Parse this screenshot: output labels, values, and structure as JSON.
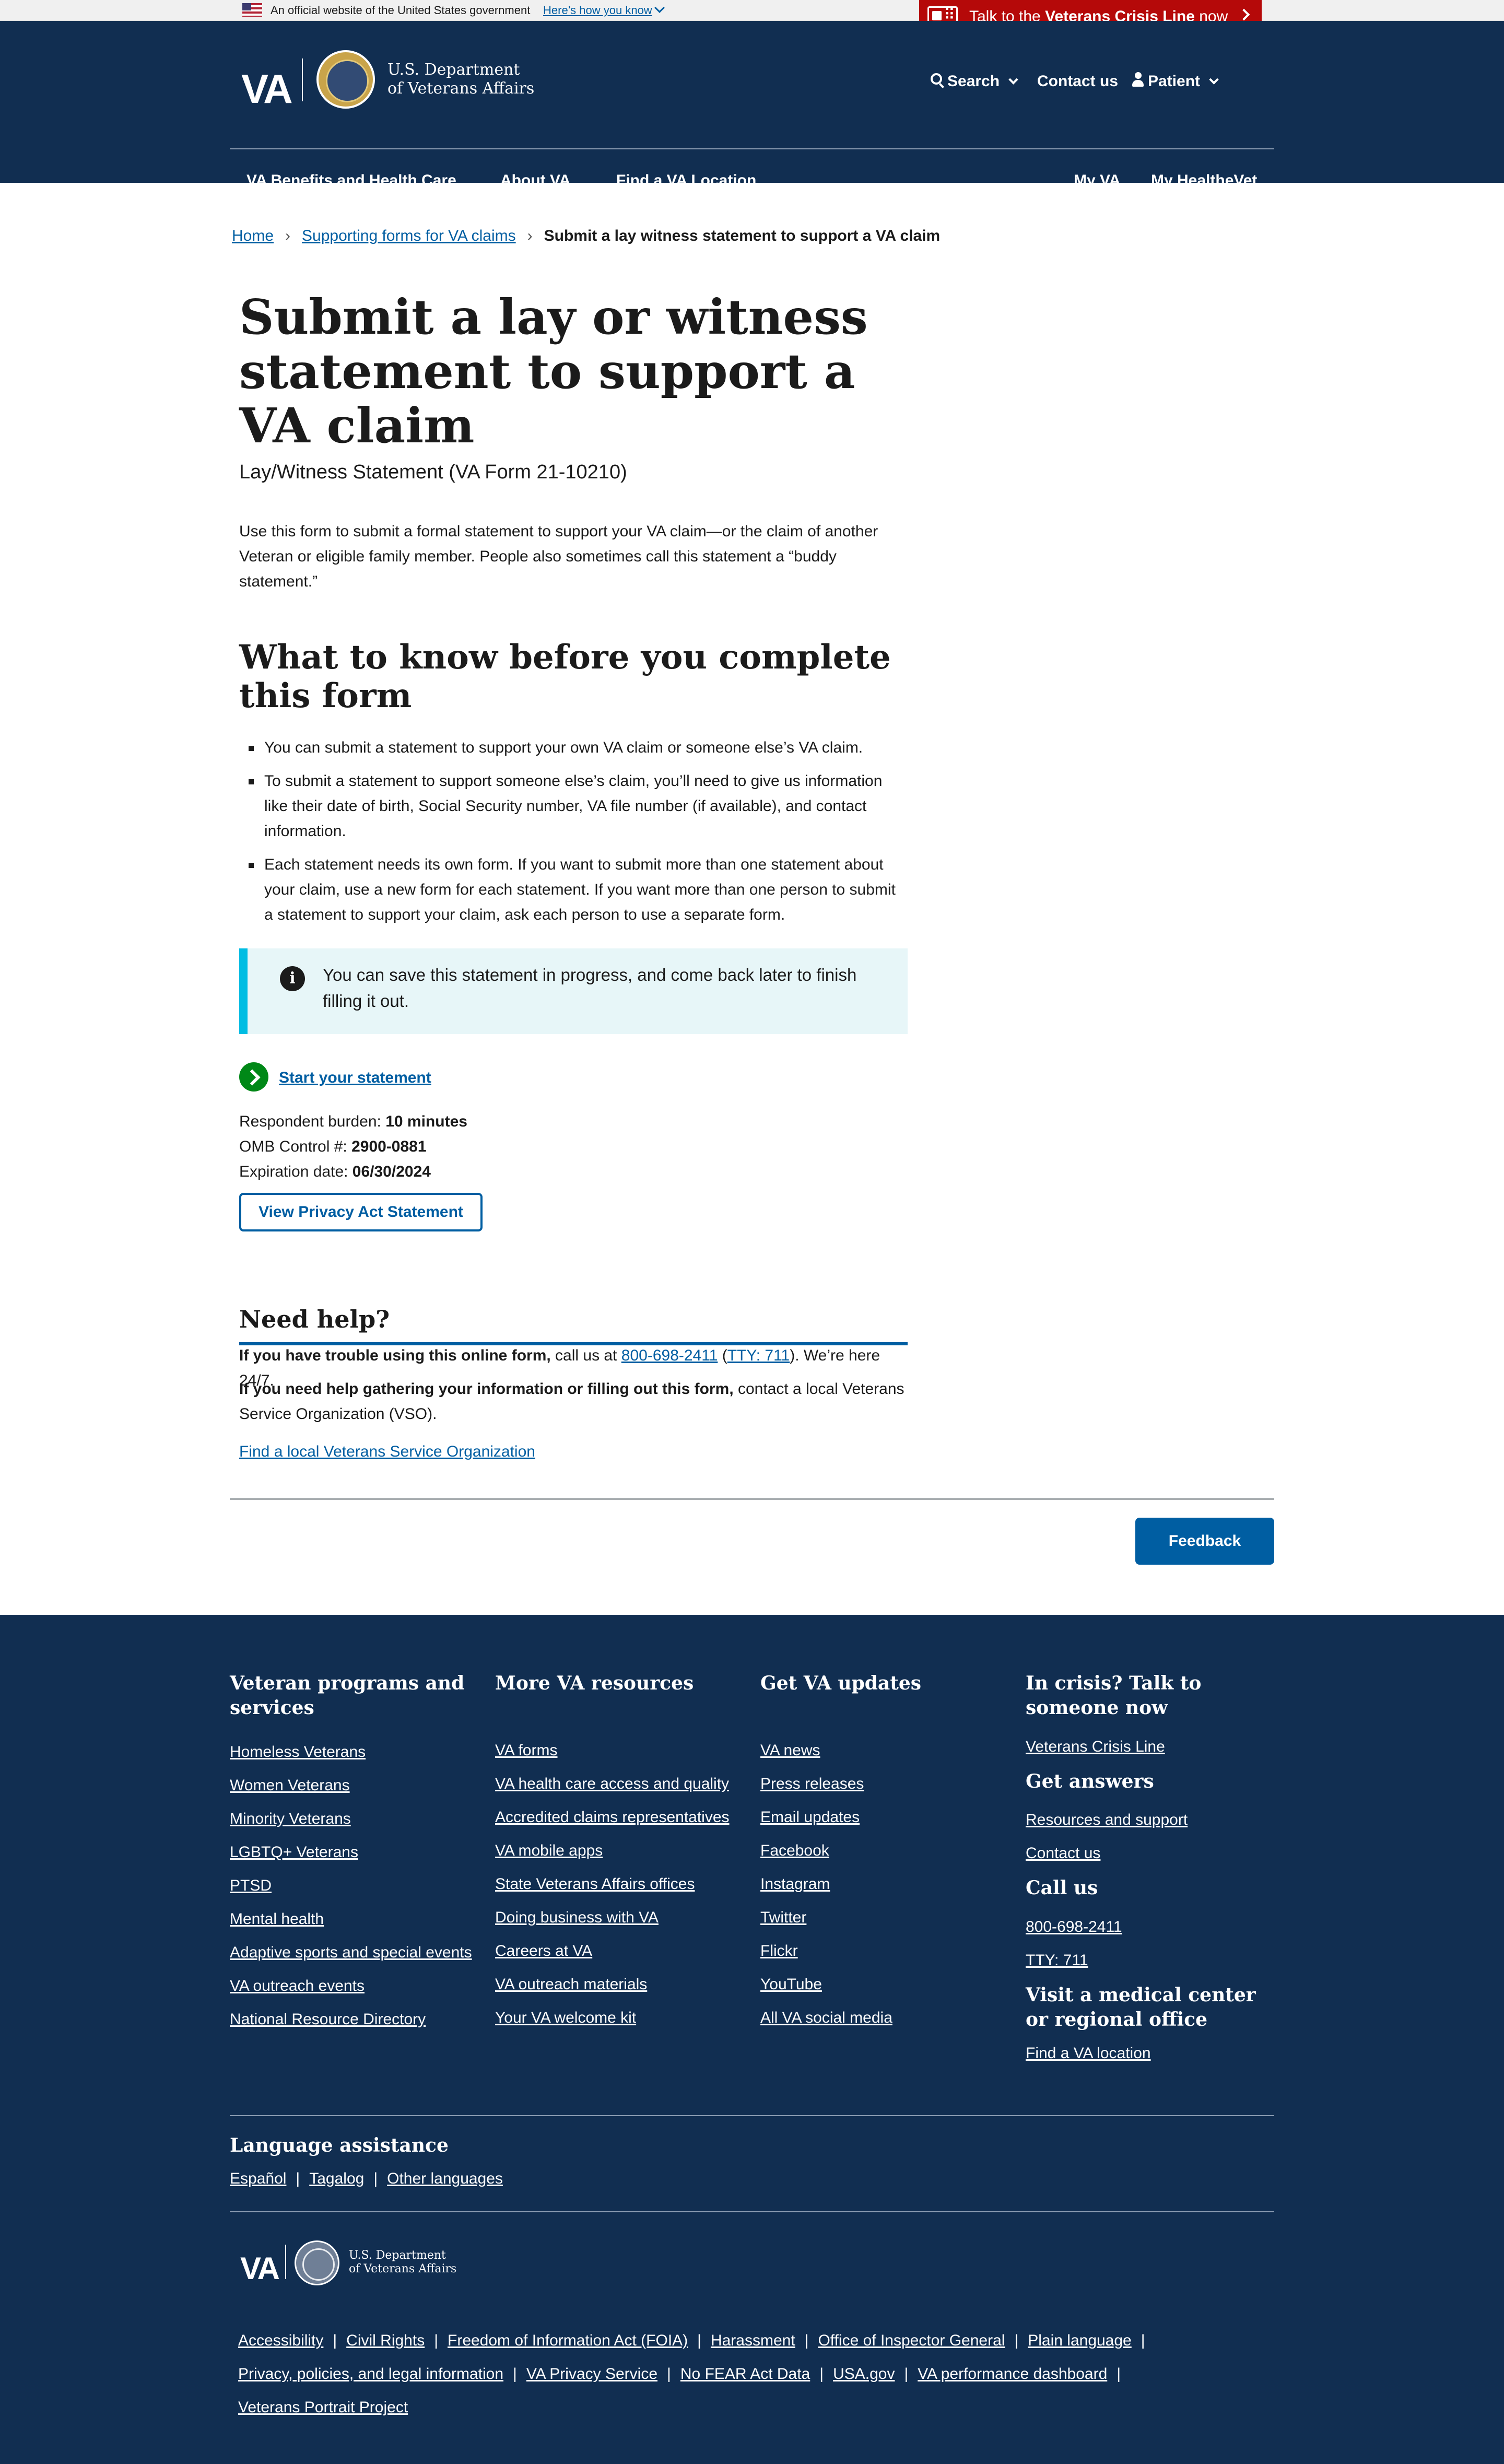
{
  "gov_banner": {
    "official_text": "An official website of the United States government",
    "how_link": "Here’s how you know"
  },
  "crisis": {
    "prefix": "Talk to the ",
    "strong": "Veterans Crisis Line",
    "suffix": " now"
  },
  "header": {
    "logo_text": "VA",
    "dept_line1": "U.S. Department",
    "dept_line2": "of Veterans Affairs",
    "search": "Search",
    "contact": "Contact us",
    "user": "Patient"
  },
  "menu": {
    "benefits": "VA Benefits and Health Care",
    "about": "About VA",
    "find": "Find a VA Location",
    "my_va": "My VA",
    "healthevet": "My HealtheVet"
  },
  "breadcrumbs": {
    "home": "Home",
    "forms": "Supporting forms for VA claims",
    "current": "Submit a lay witness statement to support a VA claim"
  },
  "page": {
    "title": "Submit a lay or witness statement to support a VA claim",
    "subtitle": "Lay/Witness Statement (VA Form 21-10210)",
    "intro": "Use this form to submit a formal statement to support your VA claim—or the claim of another Veteran or eligible family member. People also sometimes call this statement a “buddy statement.”",
    "know_heading": "What to know before you complete this form",
    "bullets": [
      "You can submit a statement to support your own VA claim or someone else’s VA claim.",
      "To submit a statement to support someone else’s claim, you’ll need to give us information like their date of birth, Social Security number, VA file number (if available), and contact information.",
      "Each statement needs its own form. If you want to submit more than one statement about your claim, use a new form for each statement. If you want more than one person to submit a statement to support your claim, ask each person to use a separate form."
    ],
    "alert": "You can save this statement in progress, and come back later to finish filling it out.",
    "start_link": "Start your statement",
    "burden_label": "Respondent burden: ",
    "burden_value": "10 minutes",
    "omb_label": "OMB Control #: ",
    "omb_value": "2900-0881",
    "expiration_label": "Expiration date: ",
    "expiration_value": "06/30/2024",
    "privacy_button": "View Privacy Act Statement"
  },
  "help": {
    "heading": "Need help?",
    "trouble_strong": "If you have trouble using this online form,",
    "trouble_text": " call us at ",
    "phone": "800-698-2411",
    "tty": "TTY: 711",
    "trouble_end": "). We’re here 24/7.",
    "gather_strong": "If you need help gathering your information or filling out this form,",
    "gather_text": " contact a local Veterans Service Organization (VSO).",
    "vso_link": "Find a local Veterans Service Organization"
  },
  "feedback": "Feedback",
  "footer": {
    "col1": {
      "heading": "Veteran programs and services",
      "links": [
        "Homeless Veterans",
        "Women Veterans",
        "Minority Veterans",
        "LGBTQ+ Veterans",
        "PTSD",
        "Mental health",
        "Adaptive sports and special events",
        "VA outreach events",
        "National Resource Directory"
      ]
    },
    "col2": {
      "heading": "More VA resources",
      "links": [
        "VA forms",
        "VA health care access and quality",
        "Accredited claims representatives",
        "VA mobile apps",
        "State Veterans Affairs offices",
        "Doing business with VA",
        "Careers at VA",
        "VA outreach materials",
        "Your VA welcome kit"
      ]
    },
    "col3": {
      "heading": "Get VA updates",
      "links": [
        "VA news",
        "Press releases",
        "Email updates",
        "Facebook",
        "Instagram",
        "Twitter",
        "Flickr",
        "YouTube",
        "All VA social media"
      ]
    },
    "col4": {
      "crisis_heading": "In crisis? Talk to someone now",
      "crisis_link": "Veterans Crisis Line",
      "answers_heading": "Get answers",
      "answers_links": [
        "Resources and support",
        "Contact us"
      ],
      "call_heading": "Call us",
      "call_links": [
        "800-698-2411",
        "TTY: 711"
      ],
      "visit_heading": "Visit a medical center or regional office",
      "visit_link": "Find a VA location"
    },
    "language": {
      "heading": "Language assistance",
      "links": [
        "Español",
        "Tagalog",
        "Other languages"
      ]
    },
    "logo_text": "VA",
    "dept_line1": "U.S. Department",
    "dept_line2": "of Veterans Affairs",
    "legal_links": [
      "Accessibility",
      "Civil Rights",
      "Freedom of Information Act (FOIA)",
      "Harassment",
      "Office of Inspector General",
      "Plain language",
      "Privacy, policies, and legal information",
      "VA Privacy Service",
      "No FEAR Act Data",
      "USA.gov",
      "VA performance dashboard",
      "Veterans Portrait Project"
    ]
  }
}
